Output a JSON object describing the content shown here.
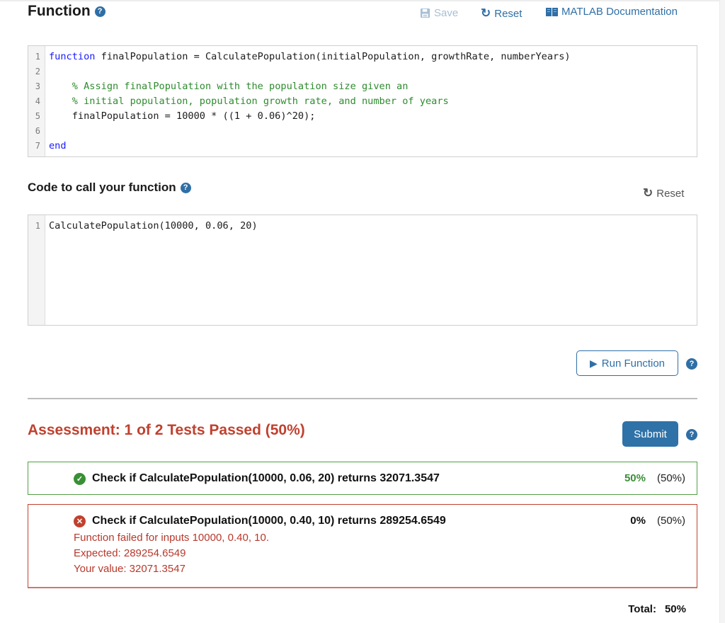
{
  "function_section": {
    "title": "Function",
    "help_icon": "question-circle-icon",
    "toolbar": {
      "save_label": "Save",
      "reset_label": "Reset",
      "docs_label": "MATLAB Documentation"
    },
    "line_numbers": [
      "1",
      "2",
      "3",
      "4",
      "5",
      "6",
      "7"
    ],
    "code_lines": [
      {
        "keyword": "function",
        "text": " finalPopulation = CalculatePopulation(initialPopulation, growthRate, numberYears)",
        "comment": ""
      },
      {
        "keyword": "",
        "text": "",
        "comment": ""
      },
      {
        "keyword": "",
        "text": "    ",
        "comment": "% Assign finalPopulation with the population size given an"
      },
      {
        "keyword": "",
        "text": "    ",
        "comment": "% initial population, population growth rate, and number of years"
      },
      {
        "keyword": "",
        "text": "    finalPopulation = 10000 * ((1 + 0.06)^20);",
        "comment": ""
      },
      {
        "keyword": "",
        "text": "",
        "comment": ""
      },
      {
        "keyword": "end",
        "text": "",
        "comment": ""
      }
    ]
  },
  "call_section": {
    "title": "Code to call your function",
    "reset_label": "Reset",
    "line_numbers": [
      "1"
    ],
    "code_lines": [
      "CalculatePopulation(10000, 0.06, 20)"
    ],
    "run_label": "Run Function"
  },
  "assessment": {
    "title": "Assessment: 1 of 2 Tests Passed (50%)",
    "submit_label": "Submit",
    "tests": [
      {
        "status": "passed",
        "label": "Check if CalculatePopulation(10000, 0.06, 20) returns 32071.3547",
        "score": "50%",
        "weight": "(50%)"
      },
      {
        "status": "failed",
        "label": "Check if CalculatePopulation(10000, 0.40, 10) returns 289254.6549",
        "details": [
          "Function failed for inputs 10000, 0.40, 10.",
          "Expected: 289254.6549",
          "Your value: 32071.3547"
        ],
        "score": "0%",
        "weight": "(50%)"
      }
    ],
    "total_label": "Total:",
    "total_value": "50%"
  },
  "colors": {
    "accent_blue": "#2f6fa6",
    "fail_red": "#c0412f",
    "pass_green": "#3a8f36",
    "comment_green": "#2e8b2e",
    "keyword_blue": "#1a1aff"
  }
}
